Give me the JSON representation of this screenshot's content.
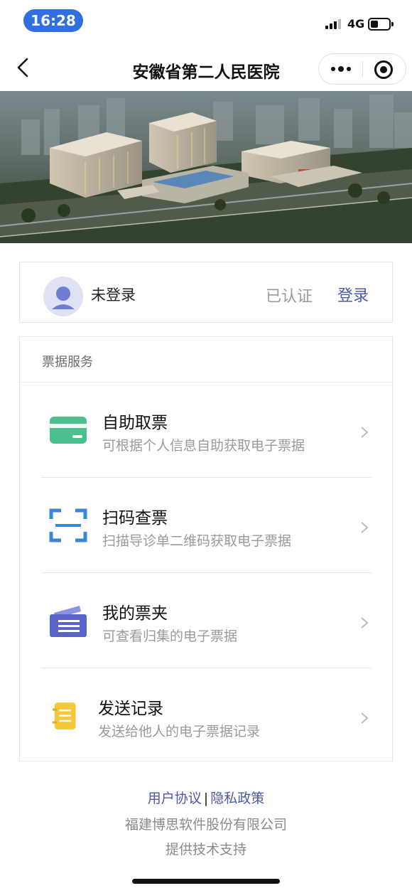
{
  "status_bar": {
    "time": "16:28",
    "network": "4G"
  },
  "nav": {
    "title": "安徽省第二人民医院"
  },
  "user": {
    "name": "未登录",
    "status": "已认证",
    "login_label": "登录"
  },
  "services": {
    "section_title": "票据服务",
    "items": [
      {
        "title": "自助取票",
        "desc": "可根据个人信息自助获取电子票据",
        "icon": "card-icon",
        "color": "#4cbf8f"
      },
      {
        "title": "扫码查票",
        "desc": "扫描导诊单二维码获取电子票据",
        "icon": "scan-icon",
        "color": "#3a86d8"
      },
      {
        "title": "我的票夹",
        "desc": "可查看归集的电子票据",
        "icon": "wallet-icon",
        "color": "#5a63c7"
      },
      {
        "title": "发送记录",
        "desc": "发送给他人的电子票据记录",
        "icon": "record-icon",
        "color": "#f3c93b"
      }
    ]
  },
  "footer": {
    "user_agreement": "用户协议",
    "separator": "|",
    "privacy_policy": "隐私政策",
    "company": "福建博思软件股份有限公司",
    "support": "提供技术支持"
  },
  "colors": {
    "accent": "#4a59a8",
    "time_pill": "#2f6fdf"
  }
}
